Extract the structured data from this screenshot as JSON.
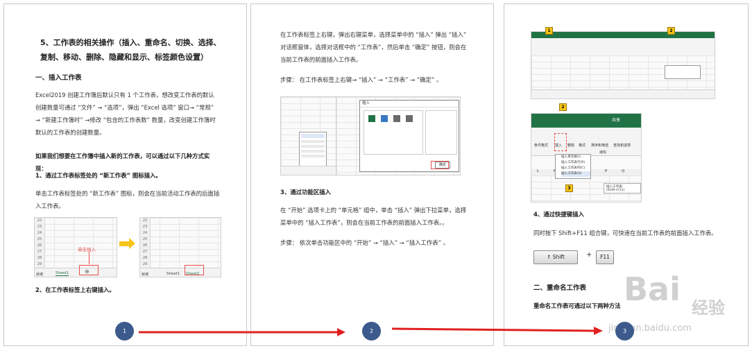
{
  "page1": {
    "title": "5、工作表的相关操作（插入、重命名、切换、选择、复制、移动、删除、隐藏和显示、标签颜色设置）",
    "section1": "一、插入工作表",
    "para1": "Excel2019 创建工作簿后默认只有 1 个工作表，想改变工作表的默认创建数量可通过 “文件” → “选项”，弹出 “Excel 选项” 窗口→ “常规” → “新建工作簿时” →修改 “包含的工作表数” 数量，改变创建工作簿时默认的工作表的创建数量。",
    "para2": "如果我们想要在工作簿中插入新的工作表，可以通过以下几种方式实现：",
    "sub1": "1、通过工作表标签处的 “新工作表” 图标插入。",
    "para3": "单击工作表标签处的 “新工作表” 图标，则会在当前活动工作表的后面插入工作表。",
    "shot_rows": [
      "22",
      "23",
      "24",
      "25",
      "26",
      "27",
      "28",
      "29",
      "30",
      "31"
    ],
    "shot_label": "单击插入",
    "sheet1": "Sheet1",
    "sheet2": "Sheet2",
    "status": "就绪",
    "sub2": "2、在工作表标签上右键插入。",
    "step": "1"
  },
  "page2": {
    "para1": "在工作表标签上右键，弹出右键菜单，选择菜单中的 “插入” 弹出 “插入” 对话框窗体，选择对话框中的 “工作表”，然后单击 “确定” 按钮，则会在当前工作表的前面插入工作表。",
    "para2": "步骤：  在工作表标签上右键→ “插入” → “工作表” → “确定” 。",
    "dialog_title": "插入",
    "dialog_ok": "确定",
    "sub3": "3、通过功能区插入",
    "para3": "在 “开始” 选项卡上的 “单元格” 组中，单击 “插入” 弹出下拉菜单，选择菜单中的 “插入工作表”，则会在当前工作表的前面插入工作表。。",
    "para4": "步骤：  依次单击功能区中的 “开始” → “插入” →  “插入工作表” 。",
    "step": "2"
  },
  "page3": {
    "menu_items": [
      "插入单元格(I)...",
      "插入工作表行(R)",
      "插入工作表列(C)",
      "插入工作表(S)"
    ],
    "tooltip": "插入工作表 (Shift+F11)",
    "columns": [
      "L",
      "M",
      "N",
      "O",
      "P",
      "Q"
    ],
    "ribbon_labels": [
      "条件格式",
      "插入",
      "删除",
      "格式",
      "排序和筛选",
      "查找和选择"
    ],
    "group_label": "编辑",
    "share": "共享",
    "sub4": "4、通过快捷键插入",
    "para1": "同时按下 Shift+F11 组合键，可快速在当前工作表的前面插入工作表。",
    "key_shift": "⇑ Shift",
    "key_plus": "+",
    "key_f11": "F11",
    "section2": "二、重命名工作表",
    "para2": "重命名工作表可通过以下两种方法",
    "step": "3",
    "watermark_brand": "Bai",
    "watermark_cn": "经验",
    "watermark_url": "jingyan.baidu.com"
  },
  "badges": [
    "1",
    "2",
    "3",
    "4"
  ],
  "colors": {
    "arrow": "#e02020",
    "step_circle": "#3d5a8c",
    "excel_green": "#217346",
    "badge": "#f5c518",
    "highlight": "#e84a4a"
  }
}
